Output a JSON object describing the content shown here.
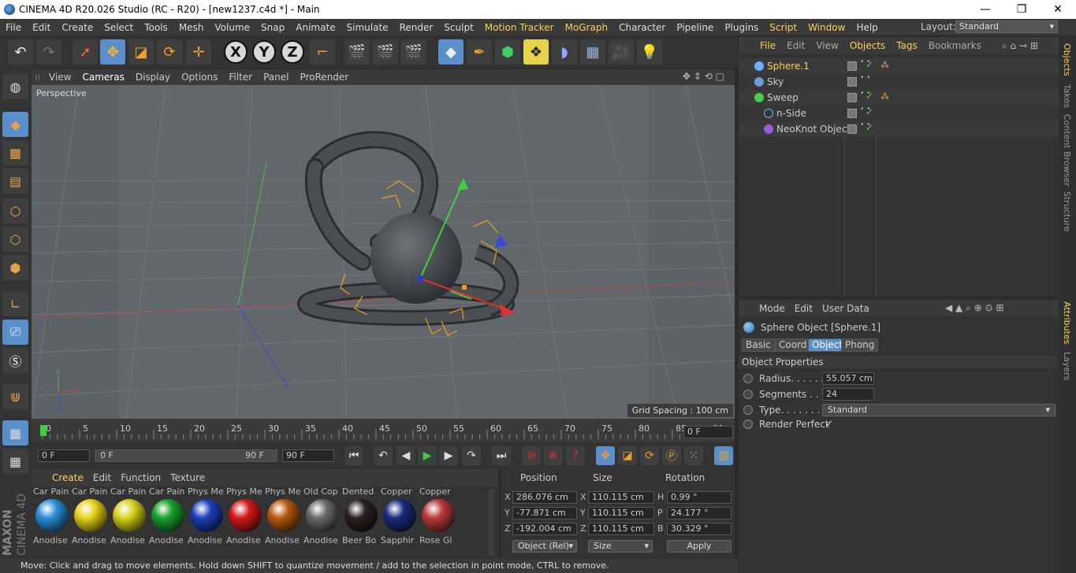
{
  "window": {
    "title": "CINEMA 4D R20.026 Studio (RC - R20) - [new1237.c4d *] - Main",
    "minimize": "—",
    "maximize": "❐",
    "close": "✕"
  },
  "menubar": [
    "File",
    "Edit",
    "Create",
    "Select",
    "Tools",
    "Mesh",
    "Volume",
    "Snap",
    "Animate",
    "Simulate",
    "Render",
    "Sculpt",
    "Motion Tracker",
    "MoGraph",
    "Character",
    "Pipeline",
    "Plugins",
    "Script",
    "Window",
    "Help"
  ],
  "menubar_highlight": [
    "Motion Tracker",
    "MoGraph",
    "Script",
    "Window"
  ],
  "layout": {
    "label": "Layout:",
    "value": "Standard"
  },
  "viewport": {
    "menu": [
      "View",
      "Cameras",
      "Display",
      "Options",
      "Filter",
      "Panel",
      "ProRender"
    ],
    "label": "Perspective",
    "grid_spacing": "Grid Spacing : 100 cm"
  },
  "timeline": {
    "ticks": [
      "0",
      "5",
      "10",
      "15",
      "20",
      "25",
      "30",
      "35",
      "40",
      "45",
      "50",
      "55",
      "60",
      "65",
      "70",
      "75",
      "80",
      "85",
      "90"
    ],
    "current_frame": "0 F",
    "start": "0 F",
    "range_start": "0 F",
    "range_end": "90 F",
    "end": "90 F"
  },
  "materials": {
    "menu": [
      "Create",
      "Edit",
      "Function",
      "Texture"
    ],
    "items": [
      {
        "top": "Car Pain",
        "label": "Anodise",
        "color": "#2a8fd9"
      },
      {
        "top": "Car Pain",
        "label": "Anodise",
        "color": "#e8d21a"
      },
      {
        "top": "Car Pain",
        "label": "Anodise",
        "color": "#d8d21a"
      },
      {
        "top": "Car Pain",
        "label": "Anodise",
        "color": "#18a02a"
      },
      {
        "top": "Phys Me",
        "label": "Anodise",
        "color": "#1a3fb8"
      },
      {
        "top": "Phys Me",
        "label": "Anodise",
        "color": "#d21818"
      },
      {
        "top": "Phys Me",
        "label": "Anodise",
        "color": "#b8580e"
      },
      {
        "top": "Old Cop",
        "label": "Anodise",
        "color": "#6a6a6a"
      },
      {
        "top": "Dented",
        "label": "Beer Bo",
        "color": "#2a2020"
      },
      {
        "top": "Copper",
        "label": "Sapphir",
        "color": "#1a2a7a"
      },
      {
        "top": "Copper",
        "label": "Rose Gl",
        "color": "#b83a3a"
      }
    ]
  },
  "coords": {
    "headers": [
      "Position",
      "Size",
      "Rotation"
    ],
    "rows": [
      {
        "axis": "X",
        "pos": "286.076 cm",
        "saxis": "X",
        "size": "110.115 cm",
        "raxis": "H",
        "rot": "0.99 °"
      },
      {
        "axis": "Y",
        "pos": "-77.871 cm",
        "saxis": "Y",
        "size": "110.115 cm",
        "raxis": "P",
        "rot": "24.177 °"
      },
      {
        "axis": "Z",
        "pos": "-192.004 cm",
        "saxis": "Z",
        "size": "110.115 cm",
        "raxis": "B",
        "rot": "30.329 °"
      }
    ],
    "mode": "Object (Rel)",
    "size_mode": "Size",
    "apply": "Apply"
  },
  "status": "Move: Click and drag to move elements. Hold down SHIFT to quantize movement / add to the selection in point mode, CTRL to remove.",
  "objects": {
    "menu": [
      "File",
      "Edit",
      "View",
      "Objects",
      "Tags",
      "Bookmarks"
    ],
    "menu_highlight": [
      "File",
      "Objects",
      "Tags"
    ],
    "items": [
      {
        "name": "Sphere.1",
        "selected": true
      },
      {
        "name": "Sky",
        "selected": false
      },
      {
        "name": "Sweep",
        "selected": false
      },
      {
        "name": "n-Side",
        "selected": false
      },
      {
        "name": "NeoKnot Object",
        "selected": false
      }
    ]
  },
  "attributes": {
    "menu": [
      "Mode",
      "Edit",
      "User Data"
    ],
    "object_title": "Sphere Object [Sphere.1]",
    "tabs": [
      "Basic",
      "Coord.",
      "Object",
      "Phong"
    ],
    "active_tab": "Object",
    "section": "Object Properties",
    "props": [
      {
        "label": "Radius. . . . . . .",
        "value": "55.057 cm"
      },
      {
        "label": "Segments . . . .",
        "value": "24"
      },
      {
        "label": "Type. . . . . . . . .",
        "value": "Standard"
      },
      {
        "label": "Render Perfect",
        "value": "✓"
      }
    ]
  },
  "sidetabs": [
    "Objects",
    "Takes",
    "Content Browser",
    "Structure",
    "Attributes",
    "Layers"
  ],
  "brand": {
    "maxon": "MAXON",
    "c4d": "CINEMA 4D"
  }
}
